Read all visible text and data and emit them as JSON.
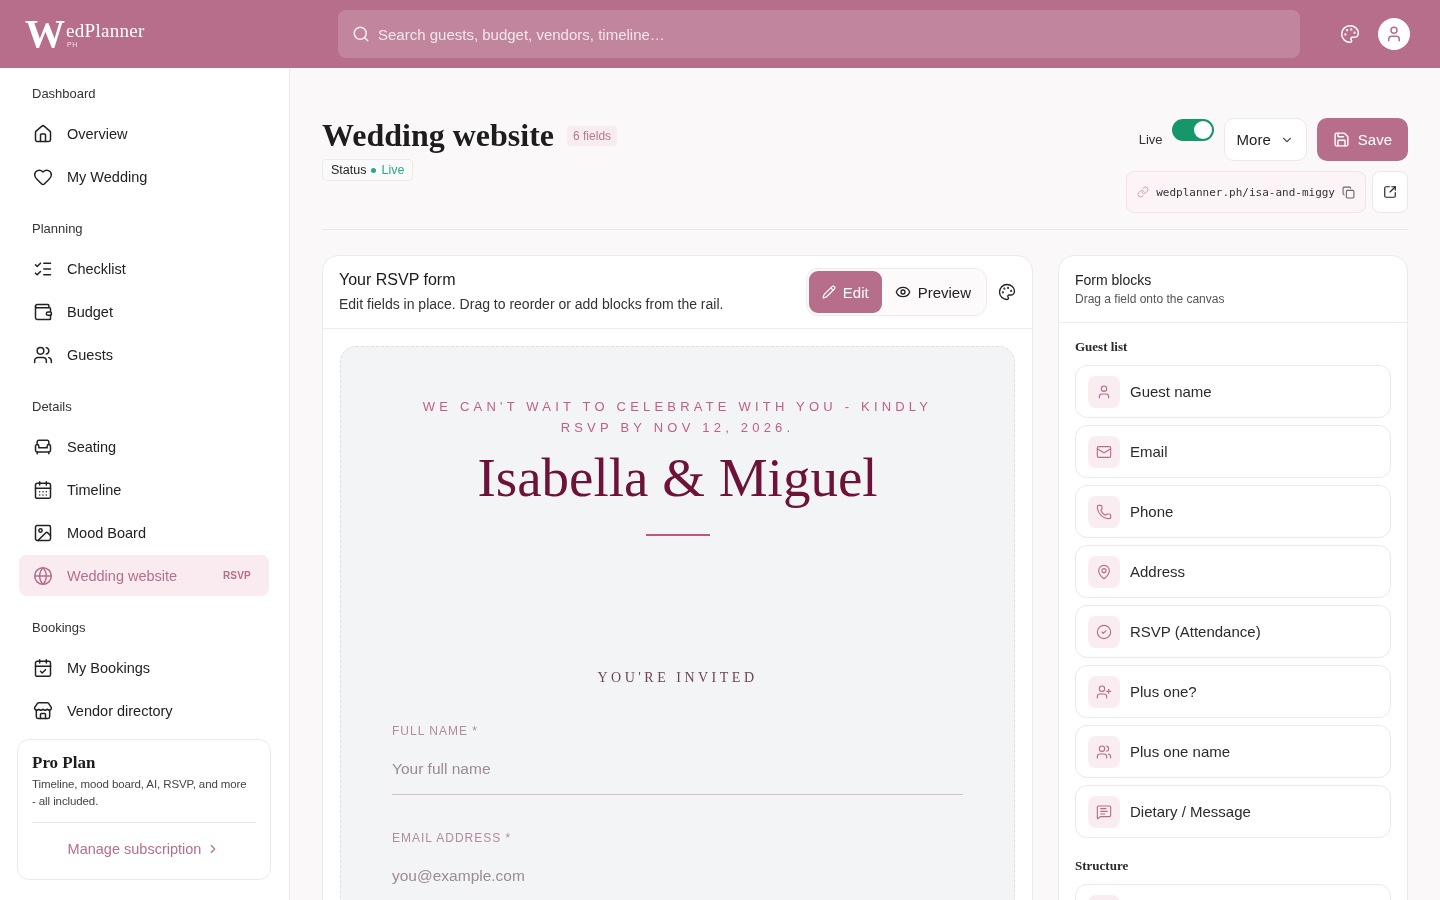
{
  "header": {
    "logo": {
      "initial": "W",
      "name": "edPlanner",
      "tag": "PH"
    },
    "search": {
      "placeholder": "Search guests, budget, vendors, timeline…"
    }
  },
  "sidebar": {
    "sections": [
      {
        "title": "Dashboard",
        "items": [
          {
            "label": "Overview",
            "selected": false
          },
          {
            "label": "My Wedding",
            "selected": false
          }
        ]
      },
      {
        "title": "Planning",
        "items": [
          {
            "label": "Checklist",
            "selected": false
          },
          {
            "label": "Budget",
            "selected": false
          },
          {
            "label": "Guests",
            "selected": false
          }
        ]
      },
      {
        "title": "Details",
        "items": [
          {
            "label": "Seating",
            "selected": false
          },
          {
            "label": "Timeline",
            "selected": false
          },
          {
            "label": "Mood Board",
            "selected": false
          },
          {
            "label": "Wedding website",
            "selected": true,
            "badge": "RSVP"
          }
        ]
      },
      {
        "title": "Bookings",
        "items": [
          {
            "label": "My Bookings",
            "selected": false
          },
          {
            "label": "Vendor directory",
            "selected": false
          }
        ]
      }
    ],
    "plan_card": {
      "title": "Pro Plan",
      "description": "Timeline, mood board, AI, RSVP, and more - all included.",
      "link": "Manage subscription"
    }
  },
  "page": {
    "title": "Wedding website",
    "field_count": "6 fields",
    "status": {
      "label": "Status",
      "value": "Live",
      "live": true
    },
    "live_toggle": {
      "label": "Live",
      "on": true
    },
    "more_button": "More",
    "save_button": "Save",
    "url": "wedplanner.ph/isa-and-miggy"
  },
  "editor": {
    "title": "Your RSVP form",
    "subtitle": "Edit fields in place. Drag to reorder or add blocks from the rail.",
    "view_modes": [
      {
        "label": "Edit",
        "selected": true
      },
      {
        "label": "Preview",
        "selected": false
      }
    ],
    "invitation": {
      "tagline": "WE CAN'T WAIT TO CELEBRATE WITH YOU - KINDLY RSVP BY NOV 12, 2026.",
      "couple": "Isabella & Miguel",
      "heading": "YOU'RE INVITED",
      "fields": [
        {
          "label": "FULL NAME *",
          "placeholder": "Your full name"
        },
        {
          "label": "EMAIL ADDRESS *",
          "placeholder": "you@example.com"
        }
      ]
    }
  },
  "blocks_panel": {
    "title": "Form blocks",
    "subtitle": "Drag a field onto the canvas",
    "groups": [
      {
        "title": "Guest list",
        "blocks": [
          {
            "label": "Guest name"
          },
          {
            "label": "Email"
          },
          {
            "label": "Phone"
          },
          {
            "label": "Address"
          },
          {
            "label": "RSVP (Attendance)"
          },
          {
            "label": "Plus one?"
          },
          {
            "label": "Plus one name"
          },
          {
            "label": "Dietary / Message"
          }
        ]
      },
      {
        "title": "Structure"
      }
    ]
  }
}
